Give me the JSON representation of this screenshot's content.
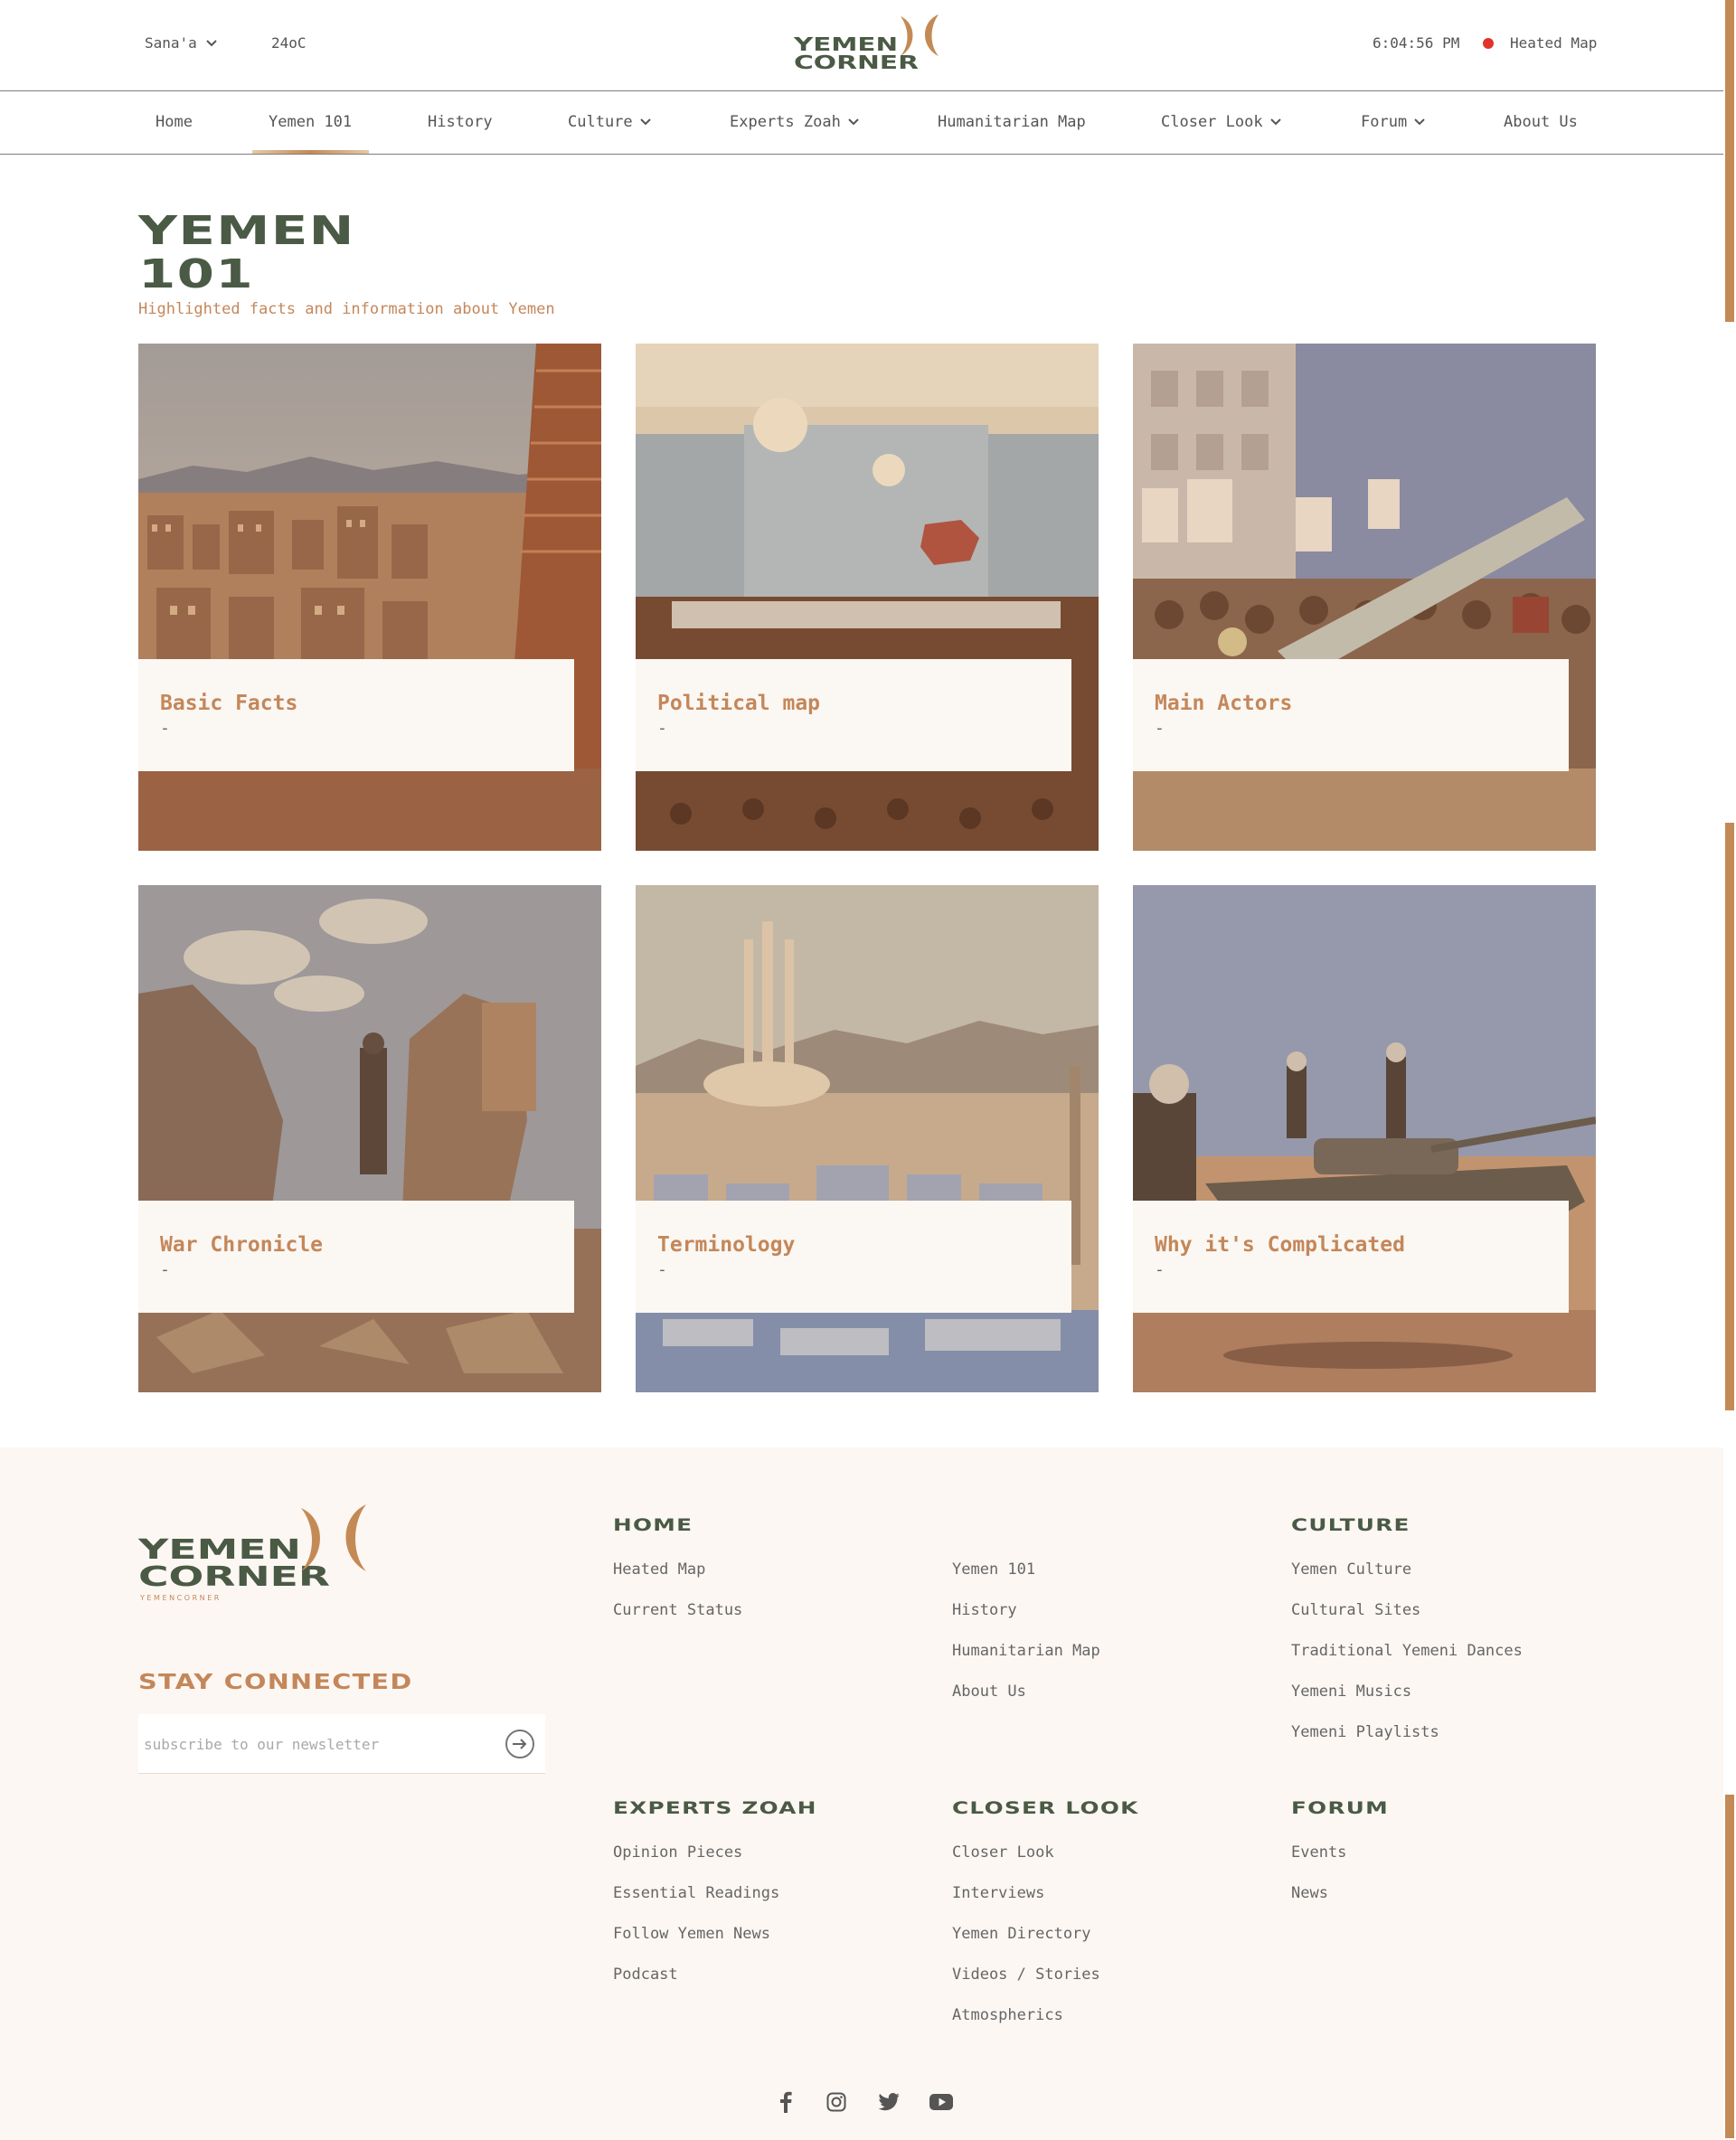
{
  "topbar": {
    "city": "Sana'a",
    "temperature": "24oC",
    "time": "6:04:56 PM",
    "heated_map": "Heated Map"
  },
  "brand": {
    "line1": "YEMEN",
    "line2": "CORNER",
    "tagline": "Y E M E N C O R N E R",
    "color_green": "#4a5a45",
    "color_copper": "#c4875a"
  },
  "nav": {
    "items": [
      {
        "label": "Home",
        "has_dropdown": false
      },
      {
        "label": "Yemen 101",
        "has_dropdown": false,
        "active": true
      },
      {
        "label": "History",
        "has_dropdown": false
      },
      {
        "label": "Culture",
        "has_dropdown": true
      },
      {
        "label": "Experts Zoah",
        "has_dropdown": true
      },
      {
        "label": "Humanitarian Map",
        "has_dropdown": false
      },
      {
        "label": "Closer Look",
        "has_dropdown": true
      },
      {
        "label": "Forum",
        "has_dropdown": true
      },
      {
        "label": "About Us",
        "has_dropdown": false
      }
    ]
  },
  "page": {
    "title_line1": "YEMEN",
    "title_line2": "101",
    "subtitle": "Highlighted facts and information about Yemen"
  },
  "cards": [
    {
      "title": "Basic Facts",
      "dash": "-",
      "scene": "old-city-skyline"
    },
    {
      "title": "Political map",
      "dash": "-",
      "scene": "conference-hall"
    },
    {
      "title": "Main Actors",
      "dash": "-",
      "scene": "street-rally"
    },
    {
      "title": "War Chronicle",
      "dash": "-",
      "scene": "ruined-buildings"
    },
    {
      "title": "Terminology",
      "dash": "-",
      "scene": "city-mosque"
    },
    {
      "title": "Why it's Complicated",
      "dash": "-",
      "scene": "tank-desert"
    }
  ],
  "footer": {
    "stay_connected": "STAY CONNECTED",
    "newsletter_placeholder": "subscribe to our newsletter",
    "columns": {
      "home": {
        "heading": "HOME",
        "links": [
          "Heated Map",
          "Current Status"
        ]
      },
      "home2": {
        "links": [
          "Yemen 101",
          "History",
          "Humanitarian Map",
          "About Us"
        ]
      },
      "culture": {
        "heading": "CULTURE",
        "links": [
          "Yemen Culture",
          "Cultural Sites",
          "Traditional Yemeni Dances",
          "Yemeni Musics",
          "Yemeni Playlists"
        ]
      },
      "experts": {
        "heading": "EXPERTS ZOAH",
        "links": [
          "Opinion Pieces",
          "Essential Readings",
          "Follow Yemen News",
          "Podcast"
        ]
      },
      "closer": {
        "heading": "CLOSER LOOK",
        "links": [
          "Closer Look",
          "Interviews",
          "Yemen Directory",
          "Videos / Stories",
          "Atmospherics"
        ]
      },
      "forum": {
        "heading": "FORUM",
        "links": [
          "Events",
          "News"
        ]
      }
    },
    "social": [
      "facebook-icon",
      "instagram-icon",
      "twitter-icon",
      "youtube-icon"
    ]
  }
}
